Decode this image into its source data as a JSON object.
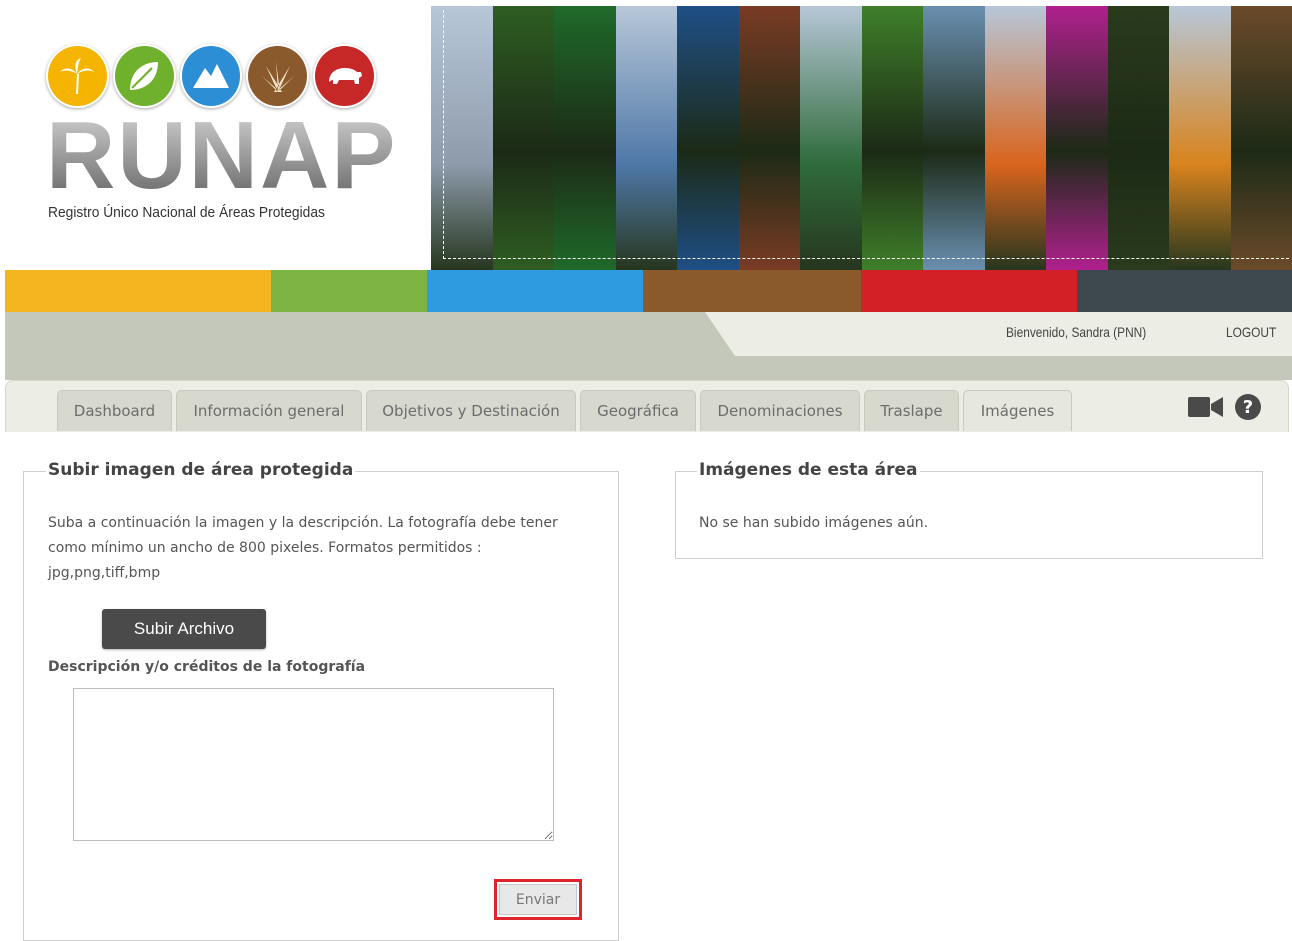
{
  "header": {
    "logo_text": "RUNAP",
    "tagline": "Registro Único Nacional de Áreas Protegidas",
    "logo_icons": [
      {
        "name": "palm-icon",
        "color": "#f4b400"
      },
      {
        "name": "leaf-icon",
        "color": "#6fb12c"
      },
      {
        "name": "mountain-icon",
        "color": "#2c8fd6"
      },
      {
        "name": "grass-icon",
        "color": "#8a5a2c"
      },
      {
        "name": "bear-icon",
        "color": "#c62828"
      }
    ],
    "color_bar": [
      "#f5b51f",
      "#7cb342",
      "#2e9be0",
      "#8a5a2c",
      "#d32027",
      "#3c474e"
    ],
    "collage_colors": [
      "#8e9bab",
      "#2e5d22",
      "#1f6a2a",
      "#4f78a8",
      "#1f4f86",
      "#7a3b24",
      "#2f6b3a",
      "#3f7f2a",
      "#6a8fb0",
      "#d9641e",
      "#b0208e",
      "#2a3a1c",
      "#d8831d",
      "#6b4a2a"
    ]
  },
  "userbar": {
    "welcome": "Bienvenido, Sandra (PNN)",
    "logout": "LOGOUT"
  },
  "tabs": [
    {
      "label": "Dashboard"
    },
    {
      "label": "Información general"
    },
    {
      "label": "Objetivos y Destinación"
    },
    {
      "label": "Geográfica"
    },
    {
      "label": "Denominaciones"
    },
    {
      "label": "Traslape"
    },
    {
      "label": "Imágenes",
      "active": true
    }
  ],
  "toolbar_icons": [
    "video-icon",
    "help-icon"
  ],
  "upload_panel": {
    "title": "Subir imagen de área protegida",
    "description_lines": [
      "Suba a continuación la imagen y la descripción. La fotografía debe tener",
      "como mínimo un ancho de 800 pixeles. Formatos permitidos :",
      "jpg,png,tiff,bmp"
    ],
    "upload_button": "Subir Archivo",
    "field_label": "Descripción y/o créditos de la fotografía",
    "field_value": "",
    "submit_button": "Enviar"
  },
  "images_panel": {
    "title": "Imágenes de esta área",
    "empty_text": "No se han subido imágenes aún."
  }
}
